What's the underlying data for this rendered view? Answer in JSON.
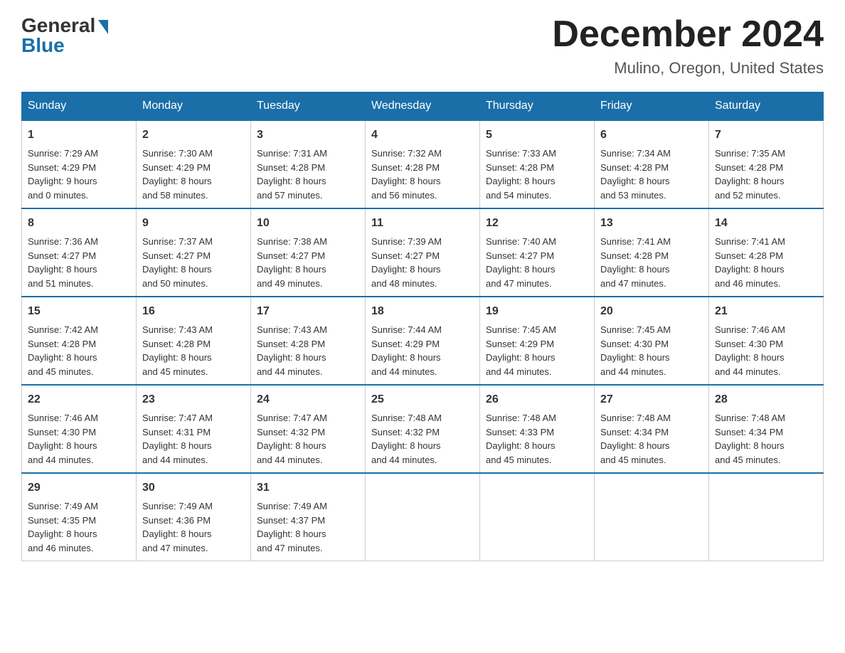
{
  "header": {
    "logo_general": "General",
    "logo_blue": "Blue",
    "title": "December 2024",
    "location": "Mulino, Oregon, United States"
  },
  "days_of_week": [
    "Sunday",
    "Monday",
    "Tuesday",
    "Wednesday",
    "Thursday",
    "Friday",
    "Saturday"
  ],
  "weeks": [
    [
      {
        "day": "1",
        "sunrise": "7:29 AM",
        "sunset": "4:29 PM",
        "daylight": "9 hours and 0 minutes."
      },
      {
        "day": "2",
        "sunrise": "7:30 AM",
        "sunset": "4:29 PM",
        "daylight": "8 hours and 58 minutes."
      },
      {
        "day": "3",
        "sunrise": "7:31 AM",
        "sunset": "4:28 PM",
        "daylight": "8 hours and 57 minutes."
      },
      {
        "day": "4",
        "sunrise": "7:32 AM",
        "sunset": "4:28 PM",
        "daylight": "8 hours and 56 minutes."
      },
      {
        "day": "5",
        "sunrise": "7:33 AM",
        "sunset": "4:28 PM",
        "daylight": "8 hours and 54 minutes."
      },
      {
        "day": "6",
        "sunrise": "7:34 AM",
        "sunset": "4:28 PM",
        "daylight": "8 hours and 53 minutes."
      },
      {
        "day": "7",
        "sunrise": "7:35 AM",
        "sunset": "4:28 PM",
        "daylight": "8 hours and 52 minutes."
      }
    ],
    [
      {
        "day": "8",
        "sunrise": "7:36 AM",
        "sunset": "4:27 PM",
        "daylight": "8 hours and 51 minutes."
      },
      {
        "day": "9",
        "sunrise": "7:37 AM",
        "sunset": "4:27 PM",
        "daylight": "8 hours and 50 minutes."
      },
      {
        "day": "10",
        "sunrise": "7:38 AM",
        "sunset": "4:27 PM",
        "daylight": "8 hours and 49 minutes."
      },
      {
        "day": "11",
        "sunrise": "7:39 AM",
        "sunset": "4:27 PM",
        "daylight": "8 hours and 48 minutes."
      },
      {
        "day": "12",
        "sunrise": "7:40 AM",
        "sunset": "4:27 PM",
        "daylight": "8 hours and 47 minutes."
      },
      {
        "day": "13",
        "sunrise": "7:41 AM",
        "sunset": "4:28 PM",
        "daylight": "8 hours and 47 minutes."
      },
      {
        "day": "14",
        "sunrise": "7:41 AM",
        "sunset": "4:28 PM",
        "daylight": "8 hours and 46 minutes."
      }
    ],
    [
      {
        "day": "15",
        "sunrise": "7:42 AM",
        "sunset": "4:28 PM",
        "daylight": "8 hours and 45 minutes."
      },
      {
        "day": "16",
        "sunrise": "7:43 AM",
        "sunset": "4:28 PM",
        "daylight": "8 hours and 45 minutes."
      },
      {
        "day": "17",
        "sunrise": "7:43 AM",
        "sunset": "4:28 PM",
        "daylight": "8 hours and 44 minutes."
      },
      {
        "day": "18",
        "sunrise": "7:44 AM",
        "sunset": "4:29 PM",
        "daylight": "8 hours and 44 minutes."
      },
      {
        "day": "19",
        "sunrise": "7:45 AM",
        "sunset": "4:29 PM",
        "daylight": "8 hours and 44 minutes."
      },
      {
        "day": "20",
        "sunrise": "7:45 AM",
        "sunset": "4:30 PM",
        "daylight": "8 hours and 44 minutes."
      },
      {
        "day": "21",
        "sunrise": "7:46 AM",
        "sunset": "4:30 PM",
        "daylight": "8 hours and 44 minutes."
      }
    ],
    [
      {
        "day": "22",
        "sunrise": "7:46 AM",
        "sunset": "4:30 PM",
        "daylight": "8 hours and 44 minutes."
      },
      {
        "day": "23",
        "sunrise": "7:47 AM",
        "sunset": "4:31 PM",
        "daylight": "8 hours and 44 minutes."
      },
      {
        "day": "24",
        "sunrise": "7:47 AM",
        "sunset": "4:32 PM",
        "daylight": "8 hours and 44 minutes."
      },
      {
        "day": "25",
        "sunrise": "7:48 AM",
        "sunset": "4:32 PM",
        "daylight": "8 hours and 44 minutes."
      },
      {
        "day": "26",
        "sunrise": "7:48 AM",
        "sunset": "4:33 PM",
        "daylight": "8 hours and 45 minutes."
      },
      {
        "day": "27",
        "sunrise": "7:48 AM",
        "sunset": "4:34 PM",
        "daylight": "8 hours and 45 minutes."
      },
      {
        "day": "28",
        "sunrise": "7:48 AM",
        "sunset": "4:34 PM",
        "daylight": "8 hours and 45 minutes."
      }
    ],
    [
      {
        "day": "29",
        "sunrise": "7:49 AM",
        "sunset": "4:35 PM",
        "daylight": "8 hours and 46 minutes."
      },
      {
        "day": "30",
        "sunrise": "7:49 AM",
        "sunset": "4:36 PM",
        "daylight": "8 hours and 47 minutes."
      },
      {
        "day": "31",
        "sunrise": "7:49 AM",
        "sunset": "4:37 PM",
        "daylight": "8 hours and 47 minutes."
      },
      null,
      null,
      null,
      null
    ]
  ],
  "labels": {
    "sunrise": "Sunrise:",
    "sunset": "Sunset:",
    "daylight": "Daylight:"
  }
}
